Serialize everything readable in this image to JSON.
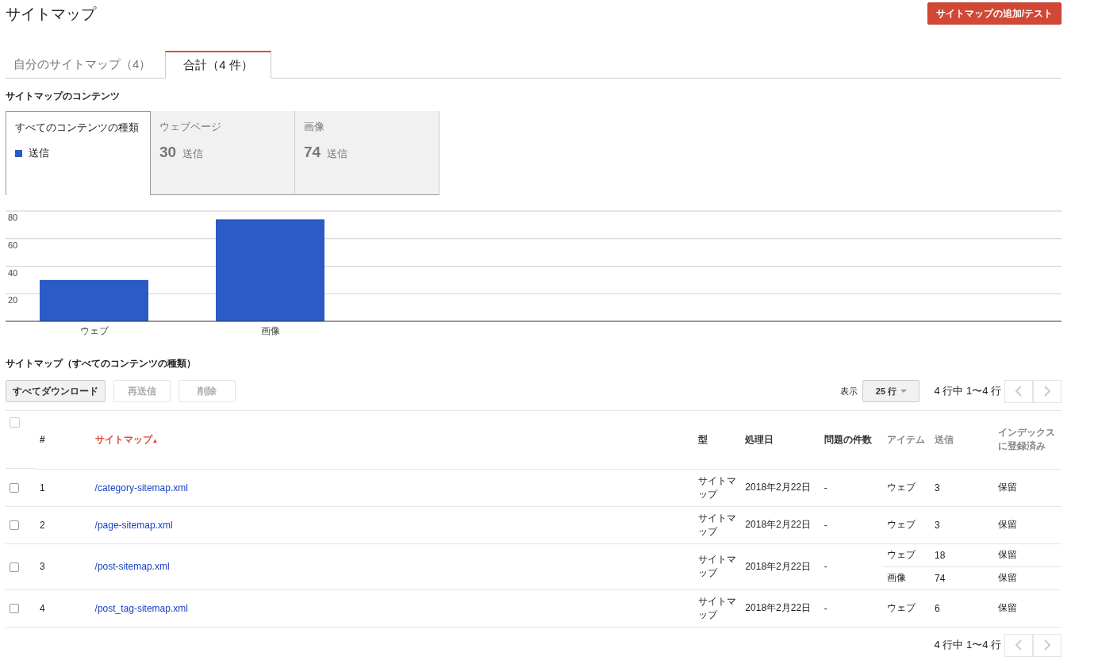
{
  "page_title": "サイトマップ",
  "add_button": "サイトマップの追加/テスト",
  "tabs": [
    {
      "label": "自分のサイトマップ（4）",
      "selected": false
    },
    {
      "label": "合計（4 件）",
      "selected": true
    }
  ],
  "contents_heading": "サイトマップのコンテンツ",
  "content_types": [
    {
      "label": "すべてのコンテンツの種類",
      "kind": "legend",
      "legend": "送信",
      "color": "#2c5bc6",
      "selected": true
    },
    {
      "label": "ウェブページ",
      "kind": "count",
      "count": "30",
      "unit": "送信",
      "selected": false
    },
    {
      "label": "画像",
      "kind": "count",
      "count": "74",
      "unit": "送信",
      "selected": false
    }
  ],
  "chart_data": {
    "type": "bar",
    "categories": [
      "ウェブ",
      "画像"
    ],
    "series": [
      {
        "color": "#2c5bc6",
        "values": [
          30,
          74
        ]
      }
    ],
    "grid": true,
    "ylim": [
      0,
      80
    ],
    "yticks": [
      20,
      40,
      60,
      80
    ]
  },
  "table_heading": "サイトマップ（すべてのコンテンツの種類）",
  "toolbar": [
    {
      "label": "すべてダウンロード",
      "disabled": false
    },
    {
      "label": "再送信",
      "disabled": true
    },
    {
      "label": "削除",
      "disabled": true
    }
  ],
  "pager_top": {
    "show_label": "表示",
    "rows_per_page": "25 行",
    "range": "4 行中 1〜4 行",
    "prev_disabled": true,
    "next_disabled": true
  },
  "columns": [
    {
      "label": "#",
      "dim": false,
      "sorted": false
    },
    {
      "label": "サイトマップ",
      "dim": false,
      "sorted": true,
      "sort_arrow": "▲"
    },
    {
      "label": "型",
      "dim": false,
      "sorted": false
    },
    {
      "label": "処理日",
      "dim": false,
      "sorted": false
    },
    {
      "label": "問題の件数",
      "dim": false,
      "sorted": false
    },
    {
      "label": "アイテム",
      "dim": true,
      "sorted": false
    },
    {
      "label": "送信",
      "dim": true,
      "sorted": false
    },
    {
      "label": "インデックスに登録済み",
      "dim": true,
      "sorted": false
    }
  ],
  "header_checked": false,
  "rows": [
    {
      "checked": false,
      "num": "1",
      "path": "/category-sitemap.xml",
      "type": "サイトマップ",
      "date": "2018年2月22日",
      "issues": "-",
      "items": [
        {
          "item": "ウェブ",
          "submitted": "3",
          "indexed": "保留"
        }
      ]
    },
    {
      "checked": false,
      "num": "2",
      "path": "/page-sitemap.xml",
      "type": "サイトマップ",
      "date": "2018年2月22日",
      "issues": "-",
      "items": [
        {
          "item": "ウェブ",
          "submitted": "3",
          "indexed": "保留"
        }
      ]
    },
    {
      "checked": false,
      "num": "3",
      "path": "/post-sitemap.xml",
      "type": "サイトマップ",
      "date": "2018年2月22日",
      "issues": "-",
      "items": [
        {
          "item": "ウェブ",
          "submitted": "18",
          "indexed": "保留"
        },
        {
          "item": "画像",
          "submitted": "74",
          "indexed": "保留"
        }
      ]
    },
    {
      "checked": false,
      "num": "4",
      "path": "/post_tag-sitemap.xml",
      "type": "サイトマップ",
      "date": "2018年2月22日",
      "issues": "-",
      "items": [
        {
          "item": "ウェブ",
          "submitted": "6",
          "indexed": "保留"
        }
      ]
    }
  ],
  "pager_bottom": {
    "range": "4 行中 1〜4 行",
    "prev_disabled": true,
    "next_disabled": true
  }
}
